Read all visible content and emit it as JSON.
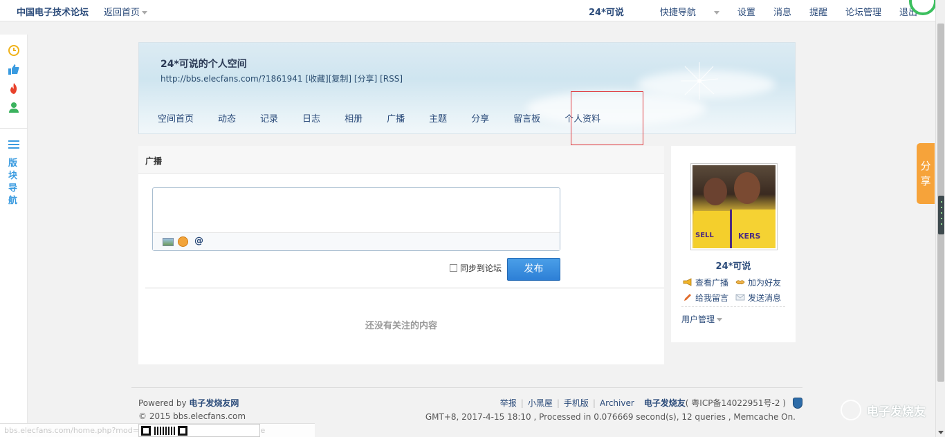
{
  "topbar": {
    "brand": "中国电子技术论坛",
    "back_home": "返回首页",
    "username": "24*可说",
    "quick_nav": "快捷导航",
    "settings": "设置",
    "messages": "消息",
    "reminders": "提醒",
    "forum_admin": "论坛管理",
    "logout": "退出"
  },
  "sidebar": {
    "icons": [
      "clock-icon",
      "thumbs-up-icon",
      "flame-icon",
      "user-icon"
    ],
    "board_nav_label": "版块导航"
  },
  "space": {
    "title": "24*可说的个人空间",
    "url": "http://bbs.elecfans.com/?1861941",
    "actions": [
      "[收藏]",
      "[复制]",
      "[分享]",
      "[RSS]"
    ],
    "nav": [
      "空间首页",
      "动态",
      "记录",
      "日志",
      "相册",
      "广播",
      "主题",
      "分享",
      "留言板",
      "个人资料"
    ]
  },
  "broadcast": {
    "section_title": "广播",
    "sync_label": "同步到论坛",
    "post_button": "发布",
    "empty_message": "还没有关注的内容"
  },
  "profile": {
    "name": "24*可说",
    "links": [
      "查看广播",
      "加为好友",
      "给我留言",
      "发送消息"
    ],
    "user_manage": "用户管理",
    "avatar_jersey_text_1": "KERS",
    "avatar_jersey_text_2": "SELL"
  },
  "share_tab": "分享",
  "footer": {
    "powered_prefix": "Powered by",
    "powered_site": "电子发烧友网",
    "copyright": "© 2015 bbs.elecfans.com",
    "links": [
      "举报",
      "小黑屋",
      "手机版",
      "Archiver"
    ],
    "site_name": "电子发烧友",
    "icp": "( 粤ICP备14022951号-2 )",
    "info": "GMT+8, 2017-4-15 18:10 , Processed in 0.076669 second(s), 12 queries , Memcache On."
  },
  "status_url": "bbs.elecfans.com/home.php?mod=space&uid=1861941&do=profile",
  "watermark": "电子发烧友"
}
